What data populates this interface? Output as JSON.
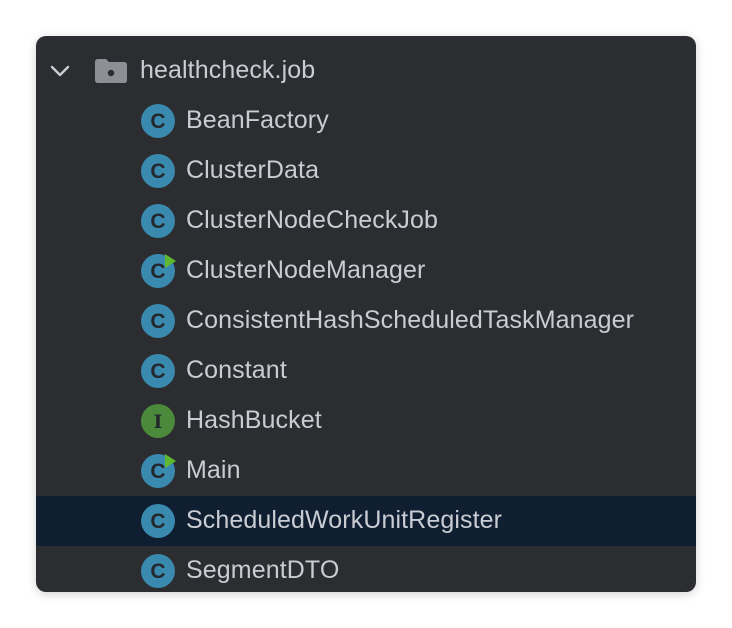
{
  "tree": {
    "folder": {
      "name": "healthcheck.job",
      "expanded": true,
      "icon": "folder-icon",
      "chevron_icon": "chevron-down-icon"
    },
    "items": [
      {
        "name": "BeanFactory",
        "kind": "class",
        "badge": "C",
        "runnable": false,
        "selected": false
      },
      {
        "name": "ClusterData",
        "kind": "class",
        "badge": "C",
        "runnable": false,
        "selected": false
      },
      {
        "name": "ClusterNodeCheckJob",
        "kind": "class",
        "badge": "C",
        "runnable": false,
        "selected": false
      },
      {
        "name": "ClusterNodeManager",
        "kind": "class",
        "badge": "C",
        "runnable": true,
        "selected": false
      },
      {
        "name": "ConsistentHashScheduledTaskManager",
        "kind": "class",
        "badge": "C",
        "runnable": false,
        "selected": false
      },
      {
        "name": "Constant",
        "kind": "class",
        "badge": "C",
        "runnable": false,
        "selected": false
      },
      {
        "name": "HashBucket",
        "kind": "interface",
        "badge": "I",
        "runnable": false,
        "selected": false
      },
      {
        "name": "Main",
        "kind": "class",
        "badge": "C",
        "runnable": true,
        "selected": false
      },
      {
        "name": "ScheduledWorkUnitRegister",
        "kind": "class",
        "badge": "C",
        "runnable": false,
        "selected": true
      },
      {
        "name": "SegmentDTO",
        "kind": "class",
        "badge": "C",
        "runnable": false,
        "selected": false
      }
    ]
  },
  "colors": {
    "panel_background": "#2b2d30",
    "selection": "#0f1f31",
    "text": "#c9cdd3",
    "class_icon": "#3a8ab0",
    "interface_icon": "#4a8a3a",
    "run_marker": "#5fb832",
    "folder_icon": "#8c9096"
  }
}
